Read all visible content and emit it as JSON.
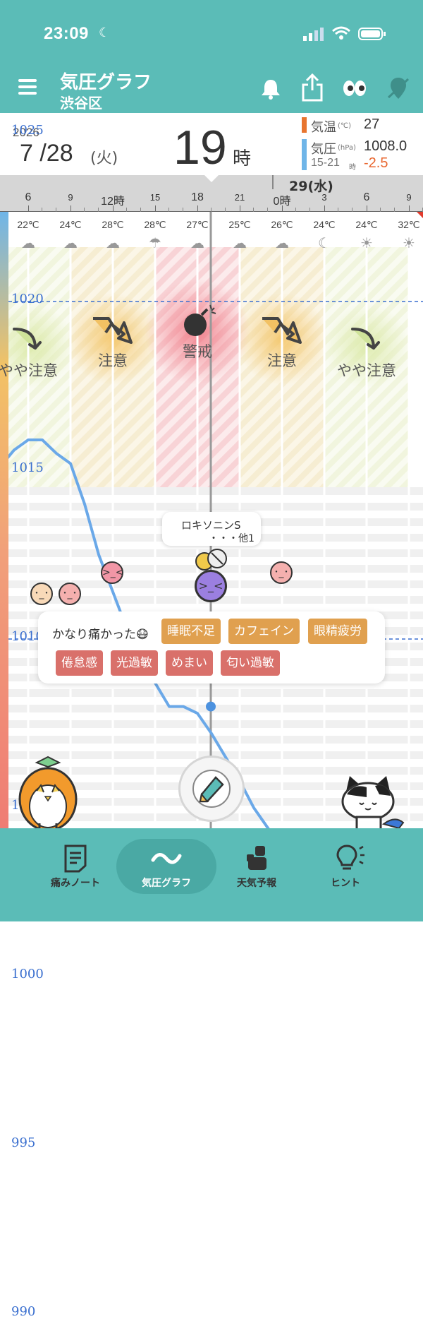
{
  "status": {
    "time": "23:09"
  },
  "header": {
    "title": "気圧グラフ",
    "subtitle": "渋谷区"
  },
  "info": {
    "year": "2026",
    "date": "7 /28",
    "weekday": "(火)",
    "hour": "19",
    "hour_unit": "時",
    "temp_label": "気温",
    "temp_unit": "(℃)",
    "temp_value": "27",
    "pressure_label": "気圧",
    "pressure_unit": "(hPa)",
    "pressure_value": "1008.0",
    "range_label": "15-21",
    "range_unit": "時",
    "range_change": "-2.5",
    "temp_color": "#e8752f",
    "pressure_color": "#6fb5e8"
  },
  "timeline": {
    "next_day": "29(水)",
    "ticks": [
      "6",
      "9",
      "12時",
      "15",
      "18",
      "21",
      "0時",
      "3",
      "6",
      "9"
    ],
    "temps": [
      "22℃",
      "24℃",
      "28℃",
      "28℃",
      "27℃",
      "25℃",
      "26℃",
      "24℃",
      "24℃",
      "32℃"
    ],
    "weather_icons": [
      "cloud",
      "cloud",
      "cloud",
      "umbrella",
      "cloud",
      "cloud",
      "cloud",
      "moon",
      "sun",
      "sun"
    ]
  },
  "pressure_axis": [
    "1025",
    "1020",
    "1015",
    "1010",
    "1005",
    "1000",
    "995",
    "990"
  ],
  "zones": [
    {
      "label": "やや注意",
      "level": "mild"
    },
    {
      "label": "注意",
      "level": "caution"
    },
    {
      "label": "警戒",
      "level": "alert"
    },
    {
      "label": "注意",
      "level": "caution"
    },
    {
      "label": "やや注意",
      "level": "mild"
    }
  ],
  "tooltip": {
    "line1": "ロキソニンS",
    "line2": "・・・他1"
  },
  "symptom_card": {
    "severity": "かなり痛かった😷",
    "tags": [
      {
        "label": "睡眠不足",
        "color": "#e0a04f"
      },
      {
        "label": "カフェイン",
        "color": "#e0a04f"
      },
      {
        "label": "眼精疲労",
        "color": "#e0a04f"
      },
      {
        "label": "倦怠感",
        "color": "#d9706a"
      },
      {
        "label": "光過敏",
        "color": "#d9706a"
      },
      {
        "label": "めまい",
        "color": "#d9706a"
      },
      {
        "label": "匂い過敏",
        "color": "#d9706a"
      }
    ]
  },
  "nav": {
    "items": [
      {
        "label": "痛みノート",
        "icon": "note-icon"
      },
      {
        "label": "気圧グラフ",
        "icon": "wave-icon",
        "active": true
      },
      {
        "label": "天気予報",
        "icon": "weather-icon"
      },
      {
        "label": "ヒント",
        "icon": "lightbulb-icon"
      }
    ]
  },
  "chart_data": {
    "type": "line",
    "title": "",
    "xlabel": "",
    "ylabel": "",
    "x": [
      "6",
      "7",
      "8",
      "9",
      "10",
      "11",
      "12",
      "13",
      "14",
      "15",
      "16",
      "17",
      "18",
      "19",
      "20",
      "21",
      "22",
      "23",
      "0",
      "1",
      "2",
      "3",
      "4",
      "5",
      "6",
      "7",
      "8",
      "9",
      "10"
    ],
    "series": [
      {
        "values": [
          1015.1,
          1015.6,
          1015.9,
          1015.9,
          1015.5,
          1015.2,
          1014.0,
          1012.5,
          1011.4,
          1010.3,
          1009.7,
          1008.7,
          1008.0,
          1008.0,
          1007.8,
          1007.2,
          1006.5,
          1005.8,
          1005.0,
          1004.4,
          1003.8,
          1003.5,
          1003.2,
          1003.0,
          1002.8,
          1002.8,
          1002.6,
          1002.2,
          1002.0
        ]
      }
    ],
    "ylim": [
      988,
      1026
    ],
    "yticks": [
      995,
      1000,
      1005,
      1010,
      1015,
      1020,
      1025
    ],
    "current_x": "19",
    "current_value": 1008.0,
    "grid": true
  }
}
